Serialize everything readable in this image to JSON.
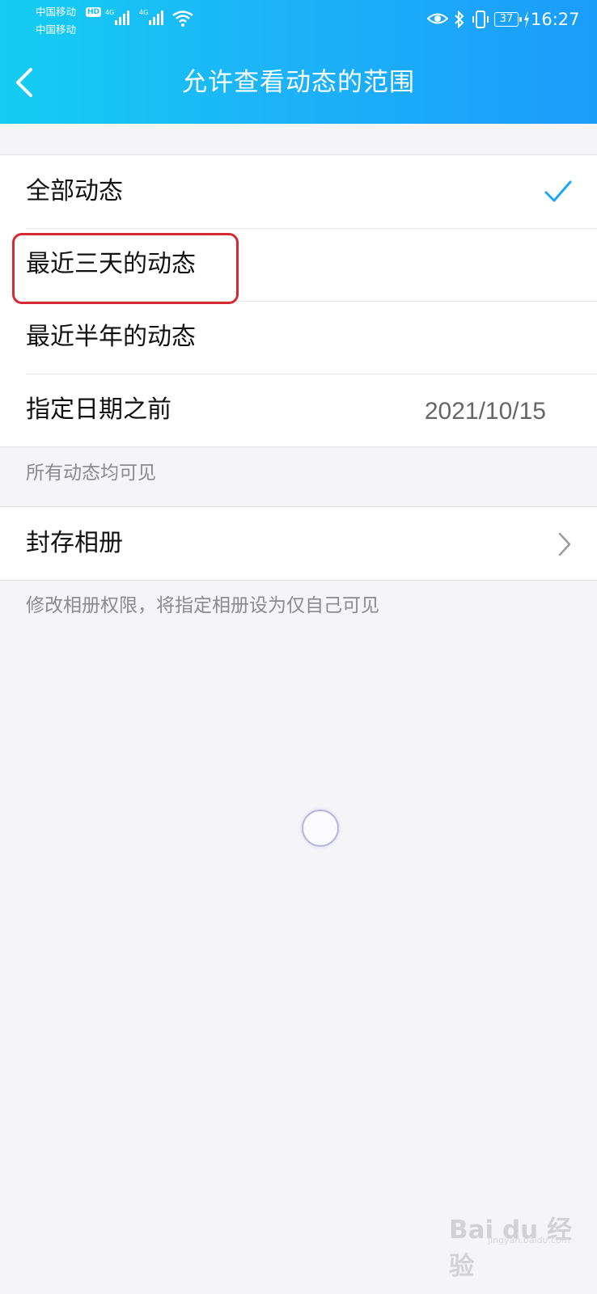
{
  "status_bar": {
    "carrier1": "中国移动",
    "carrier2": "中国移动",
    "hd_badge": "HD",
    "signal1_label": "4G",
    "signal2_label": "4G",
    "battery": "37",
    "time": "16:27"
  },
  "header": {
    "title": "允许查看动态的范围"
  },
  "scope_options": [
    {
      "label": "全部动态",
      "selected": true
    },
    {
      "label": "最近三天的动态",
      "selected": false
    },
    {
      "label": "最近半年的动态",
      "selected": false
    },
    {
      "label": "指定日期之前",
      "value": "2021/10/15"
    }
  ],
  "scope_footnote": "所有动态均可见",
  "archive": {
    "label": "封存相册",
    "footnote": "修改相册权限，将指定相册设为仅自己可见"
  },
  "watermark": {
    "brand": "Bai du 经验",
    "url": "jingyan.baidu.com"
  },
  "colors": {
    "header_start": "#14cdf2",
    "header_end": "#1a9cfb",
    "check": "#1ba7f5",
    "highlight": "#d62a33"
  },
  "icons": {
    "back": "chevron-left-icon",
    "check": "check-icon",
    "chevron": "chevron-right-icon"
  }
}
